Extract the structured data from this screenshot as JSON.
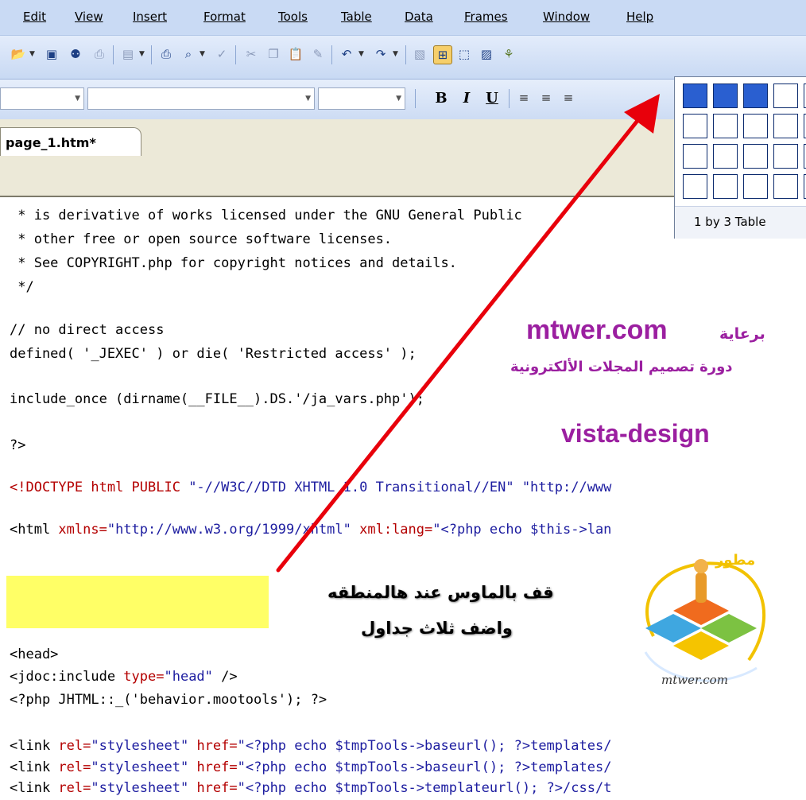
{
  "menu": [
    "Edit",
    "View",
    "Insert",
    "Format",
    "Tools",
    "Table",
    "Data",
    "Frames",
    "Window",
    "Help"
  ],
  "toolbar_icons": [
    "open-icon",
    "save-icon",
    "find-icon",
    "print-preview-icon",
    "view-icon",
    "print-icon",
    "preview-icon",
    "spelling-icon",
    "cut-icon",
    "copy-icon",
    "paste-icon",
    "format-painter-icon",
    "undo-icon",
    "redo-icon",
    "insert-picture-icon",
    "insert-table-icon",
    "layer-icon",
    "image-icon",
    "more-icon"
  ],
  "formatting": {
    "bold": "B",
    "italic": "I",
    "underline": "U"
  },
  "document_tab": "page_1.htm*",
  "table_picker": {
    "caption": "1 by 3 Table",
    "rows": 4,
    "columns": 5,
    "selected_rows": 1,
    "selected_columns": 3
  },
  "code_lines": {
    "l1": " * is derivative of works licensed under the GNU General Public",
    "l2": " * other free or open source software licenses.",
    "l3": " * See COPYRIGHT.php for copyright notices and details.",
    "l4": " */",
    "l5": "// no direct access",
    "l6": "defined( '_JEXEC' ) or die( 'Restricted access' );",
    "l7": "include_once (dirname(__FILE__).DS.'/ja_vars.php');",
    "l8": "?>",
    "l9_a": "<!DOCTYPE ",
    "l9_b": "html PUBLIC ",
    "l9_c": "\"-//W3C//DTD XHTML 1.0 Transitional//EN\" \"http://www",
    "l10_a": "<html ",
    "l10_b": "xmlns=",
    "l10_c": "\"http://www.w3.org/1999/xhtml\" ",
    "l10_d": "xml:lang=",
    "l10_e": "\"<?php echo $this->lan",
    "l11": "<head>",
    "l12_a": "<jdoc:include ",
    "l12_b": "type=",
    "l12_c": "\"head\" ",
    "l12_d": "/>",
    "l13": "<?php JHTML::_('behavior.mootools'); ?>",
    "l14_a": "<link ",
    "l14_b": "rel=",
    "l14_c": "\"stylesheet\" ",
    "l14_d": "href=",
    "l14_e": "\"<?php echo $tmpTools->baseurl(); ?>templates/",
    "l15_e": "\"<?php echo $tmpTools->baseurl(); ?>templates/",
    "l16_e": "\"<?php echo $tmpTools->templateurl(); ?>/css/t"
  },
  "watermark": {
    "site": "mtwer.com",
    "sponsor": "برعاية",
    "course": "دورة تصميم المجلات الألكترونية",
    "design": "vista-design",
    "instruction_1": "قف بالماوس عند هالمنطقه",
    "instruction_2": "واضف ثلاث جداول",
    "logo_text": "mtwer.com"
  },
  "colors": {
    "arrow": "#e8000b",
    "watermark": "#9b1fa0",
    "highlight": "#ffff66",
    "selected_cell": "#2a5fd0"
  }
}
